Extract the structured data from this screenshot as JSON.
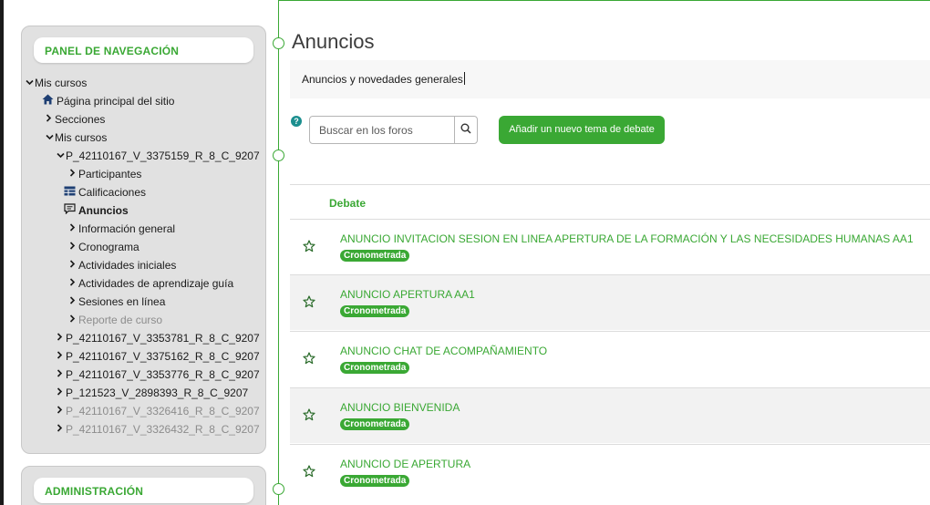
{
  "colors": {
    "accent": "#3aa834",
    "panel": "#e1e1e1",
    "row_alt": "#f2f2f2",
    "help": "#1b8f8f"
  },
  "nav_panel": {
    "title": "PANEL DE NAVEGACIÓN",
    "items": [
      {
        "label": "Mis cursos",
        "chevron": "down",
        "icon": ""
      },
      {
        "label": "Página principal del sitio",
        "chevron": "",
        "icon": "home-icon"
      },
      {
        "label": "Secciones",
        "chevron": "right",
        "icon": ""
      },
      {
        "label": "Mis cursos",
        "chevron": "down",
        "icon": ""
      },
      {
        "label": "P_42110167_V_3375159_R_8_C_9207",
        "chevron": "down",
        "icon": ""
      },
      {
        "label": "Participantes",
        "chevron": "right",
        "icon": ""
      },
      {
        "label": "Calificaciones",
        "chevron": "",
        "icon": "grades-table-icon"
      },
      {
        "label": "Anuncios",
        "chevron": "",
        "icon": "forum-icon"
      },
      {
        "label": "Información general",
        "chevron": "right",
        "icon": ""
      },
      {
        "label": "Cronograma",
        "chevron": "right",
        "icon": ""
      },
      {
        "label": "Actividades iniciales",
        "chevron": "right",
        "icon": ""
      },
      {
        "label": "Actividades de aprendizaje guía",
        "chevron": "right",
        "icon": ""
      },
      {
        "label": "Sesiones en línea",
        "chevron": "right",
        "icon": ""
      },
      {
        "label": "Reporte de curso",
        "chevron": "right",
        "icon": ""
      },
      {
        "label": "P_42110167_V_3353781_R_8_C_9207",
        "chevron": "right",
        "icon": ""
      },
      {
        "label": "P_42110167_V_3375162_R_8_C_9207",
        "chevron": "right",
        "icon": ""
      },
      {
        "label": "P_42110167_V_3353776_R_8_C_9207",
        "chevron": "right",
        "icon": ""
      },
      {
        "label": "P_121523_V_2898393_R_8_C_9207",
        "chevron": "right",
        "icon": ""
      },
      {
        "label": "P_42110167_V_3326416_R_8_C_9207",
        "chevron": "right",
        "icon": ""
      },
      {
        "label": "P_42110167_V_3326432_R_8_C_9207",
        "chevron": "right",
        "icon": ""
      }
    ]
  },
  "admin_panel": {
    "title": "ADMINISTRACIÓN"
  },
  "main": {
    "title": "Anuncios",
    "intro": "Anuncios y novedades generales",
    "search": {
      "placeholder": "Buscar en los foros",
      "value": ""
    },
    "add_button": "Añadir un nuevo tema de debate",
    "help_label": "?",
    "column_header": "Debate",
    "discussions": [
      {
        "title": "ANUNCIO INVITACION SESION EN LINEA APERTURA DE LA FORMACIÓN Y LAS NECESIDADES HUMANAS AA1",
        "badge": "Cronometrada"
      },
      {
        "title": "ANUNCIO APERTURA AA1",
        "badge": "Cronometrada"
      },
      {
        "title": "ANUNCIO CHAT DE ACOMPAÑAMIENTO",
        "badge": "Cronometrada"
      },
      {
        "title": "ANUNCIO BIENVENIDA",
        "badge": "Cronometrada"
      },
      {
        "title": "ANUNCIO DE APERTURA",
        "badge": "Cronometrada"
      }
    ]
  }
}
